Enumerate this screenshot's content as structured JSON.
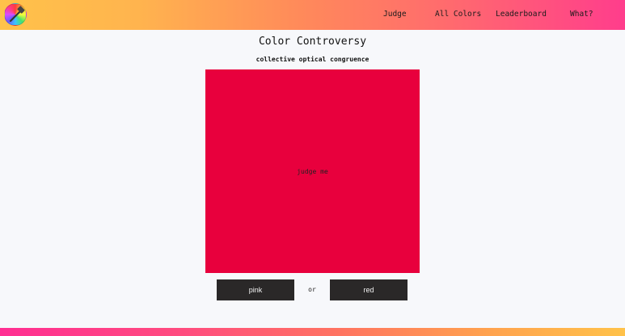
{
  "header": {
    "logo_icon": "color-wheel-hammer-icon",
    "nav": [
      {
        "label": "Judge"
      },
      {
        "label": "All Colors"
      },
      {
        "label": "Leaderboard"
      },
      {
        "label": "What?"
      }
    ]
  },
  "main": {
    "title": "Color Controversy",
    "subtitle": "collective optical congruence",
    "swatch": {
      "color": "#e8003d",
      "label": "judge me"
    },
    "choices": {
      "left_label": "pink",
      "separator": "or",
      "right_label": "red"
    }
  },
  "colors": {
    "button_bg": "#2a2828",
    "page_bg": "#f7f8fb"
  }
}
